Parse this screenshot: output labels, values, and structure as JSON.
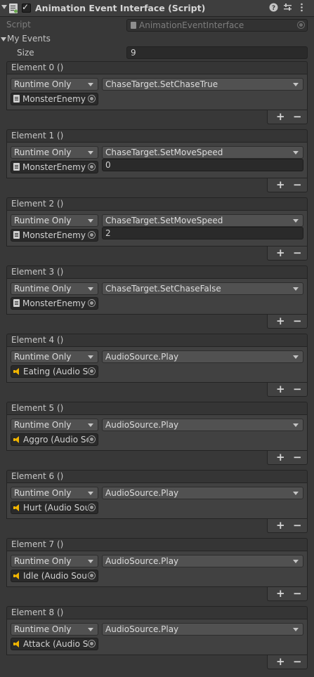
{
  "header": {
    "title": "Animation Event Interface (Script)",
    "icons": [
      "help-icon",
      "preset-icon",
      "kebab-menu-icon"
    ]
  },
  "script_row": {
    "label": "Script",
    "value": "AnimationEventInterface"
  },
  "events": {
    "label": "My Events",
    "size_label": "Size",
    "size_value": "9"
  },
  "elements": [
    {
      "title": "Element 0 ()",
      "mode": "Runtime Only",
      "function": "ChaseTarget.SetChaseTrue",
      "object": "MonsterEnemy (",
      "object_icon": "script-icon",
      "argument": null
    },
    {
      "title": "Element 1 ()",
      "mode": "Runtime Only",
      "function": "ChaseTarget.SetMoveSpeed",
      "object": "MonsterEnemy (",
      "object_icon": "script-icon",
      "argument": "0"
    },
    {
      "title": "Element 2 ()",
      "mode": "Runtime Only",
      "function": "ChaseTarget.SetMoveSpeed",
      "object": "MonsterEnemy (",
      "object_icon": "script-icon",
      "argument": "2"
    },
    {
      "title": "Element 3 ()",
      "mode": "Runtime Only",
      "function": "ChaseTarget.SetChaseFalse",
      "object": "MonsterEnemy (",
      "object_icon": "script-icon",
      "argument": null
    },
    {
      "title": "Element 4 ()",
      "mode": "Runtime Only",
      "function": "AudioSource.Play",
      "object": "Eating (Audio So",
      "object_icon": "audio-source-icon",
      "argument": null
    },
    {
      "title": "Element 5 ()",
      "mode": "Runtime Only",
      "function": "AudioSource.Play",
      "object": "Aggro (Audio So",
      "object_icon": "audio-source-icon",
      "argument": null
    },
    {
      "title": "Element 6 ()",
      "mode": "Runtime Only",
      "function": "AudioSource.Play",
      "object": "Hurt (Audio Sour",
      "object_icon": "audio-source-icon",
      "argument": null
    },
    {
      "title": "Element 7 ()",
      "mode": "Runtime Only",
      "function": "AudioSource.Play",
      "object": "Idle (Audio Sourc",
      "object_icon": "audio-source-icon",
      "argument": null
    },
    {
      "title": "Element 8 ()",
      "mode": "Runtime Only",
      "function": "AudioSource.Play",
      "object": "Attack (Audio Sc",
      "object_icon": "audio-source-icon",
      "argument": null
    }
  ],
  "list_controls": {
    "add": "+",
    "remove": "−"
  }
}
